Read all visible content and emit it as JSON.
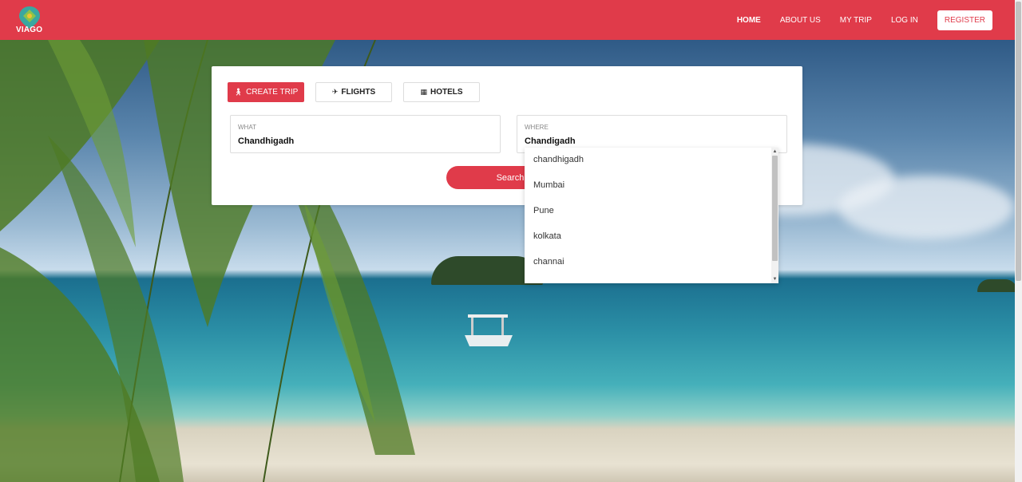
{
  "brand": {
    "name": "VIAGO"
  },
  "nav": {
    "items": [
      {
        "label": "HOME",
        "active": true
      },
      {
        "label": "ABOUT US",
        "active": false
      },
      {
        "label": "MY TRIP",
        "active": false
      },
      {
        "label": "LOG IN",
        "active": false
      }
    ],
    "register_label": "REGISTER"
  },
  "search": {
    "tabs": [
      {
        "label": "CREATE TRIP",
        "icon": "walking-person-icon",
        "active": true
      },
      {
        "label": "FLIGHTS",
        "icon": "plane-icon",
        "active": false
      },
      {
        "label": "HOTELS",
        "icon": "hotel-building-icon",
        "active": false
      }
    ],
    "what": {
      "label": "WHAT",
      "value": "Chandhigadh"
    },
    "where": {
      "label": "WHERE",
      "value": "Chandigadh"
    },
    "button_label": "Search"
  },
  "suggestions": [
    "chandhigadh",
    "Mumbai",
    "Pune",
    "kolkata",
    "channai"
  ],
  "colors": {
    "primary": "#e03b4a",
    "white": "#ffffff"
  }
}
